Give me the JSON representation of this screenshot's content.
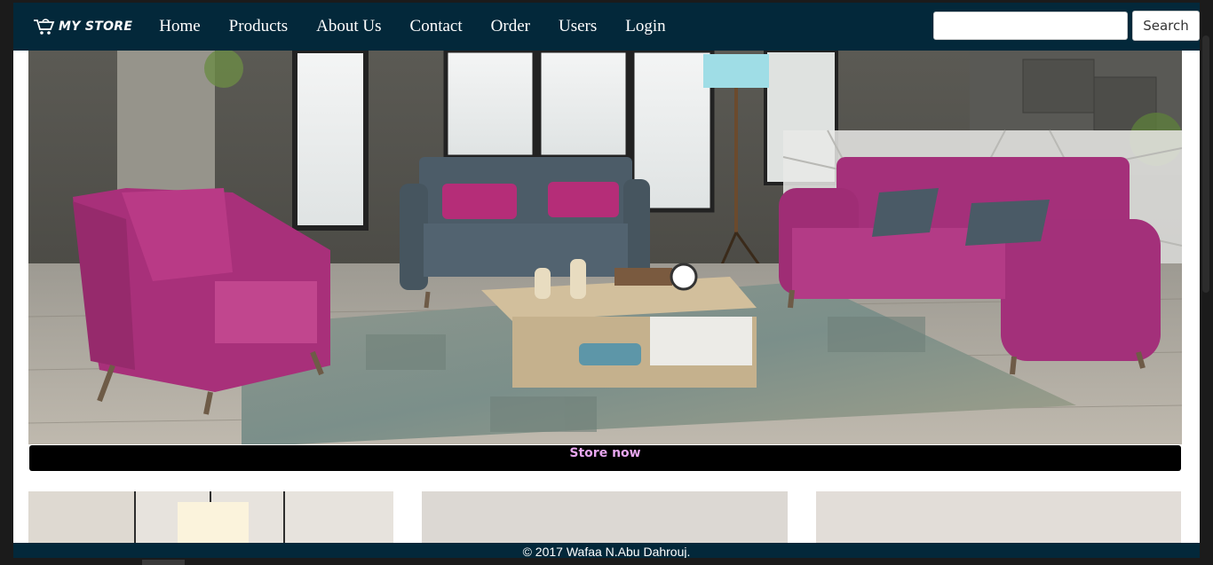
{
  "brand": {
    "name": "MY STORE",
    "icon": "cart-icon"
  },
  "nav": {
    "items": [
      {
        "label": "Home"
      },
      {
        "label": "Products"
      },
      {
        "label": "About Us"
      },
      {
        "label": "Contact"
      },
      {
        "label": "Order"
      },
      {
        "label": "Users"
      },
      {
        "label": "Login"
      }
    ]
  },
  "search": {
    "value": "",
    "placeholder": "",
    "button_label": "Search"
  },
  "hero": {
    "cta_label": "Store now"
  },
  "footer": {
    "copyright": "© 2017 Wafaa N.Abu Dahrouj."
  },
  "colors": {
    "navbar": "#03283a",
    "cta_text": "#e7a6ef",
    "cta_bar": "#000000",
    "sofa_magenta": "#a8307a",
    "sofa_slate": "#4a5a66"
  }
}
